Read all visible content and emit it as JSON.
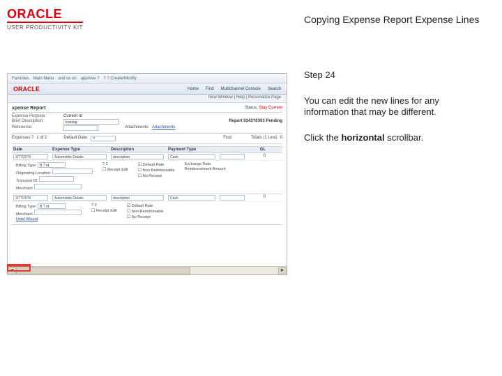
{
  "brand": {
    "name": "ORACLE",
    "product": "USER PRODUCTIVITY KIT"
  },
  "right": {
    "title": "Copying Expense Report Expense Lines",
    "step": "Step 24",
    "para1": "You can edit the new lines for any information that may be different.",
    "para2_pre": "Click the ",
    "para2_bold": "horizontal",
    "para2_post": " scrollbar."
  },
  "shot": {
    "menubar": [
      "Favorites",
      "Main Menu",
      "and so on",
      "approve ?",
      "? ? Create/Modify",
      "?"
    ],
    "toolbar_brand": "ORACLE",
    "toolbar_items": [
      "Home",
      "Find",
      "Multichannel Console",
      "Search"
    ],
    "subbar": "New Window | Help | Personalize Page",
    "report": {
      "title_left": "xpense Report",
      "status_label": "Status:",
      "status_value": "Stay Current",
      "center": "Report 9343?0303  Pending",
      "purpose_k": "Expense Purpose:",
      "purpose_v": "Current rd",
      "desc_k": "Brief Description:",
      "desc_v": "training",
      "ref_k": "Reference:",
      "attach_k": "Attachments:",
      "attach_v": "Attachments",
      "exp_k": "Expenses ?",
      "exp_v": "1  of 2",
      "def_date_k": "Default Date:",
      "def_date_v": "?",
      "find_label": "Find",
      "totals_k": "Totals (1 Line)",
      "totals_v": "0"
    },
    "columns": [
      "Date",
      "Expense Type",
      "Description",
      "Payment Type",
      "",
      "GL"
    ],
    "rows": [
      {
        "date": "3/??/20?0",
        "type": "Automobile Details",
        "desc": "description",
        "pay": "Cash",
        "gl": "0"
      },
      {
        "date": "3/??/20?0",
        "type": "Automobile Details",
        "desc": "description",
        "pay": "Cash",
        "gl": "0"
      }
    ],
    "detail": {
      "billing_type_k": "Billing Type:",
      "billing_type_v": "B  ? rd",
      "originating_k": "Originating Location:",
      "transport_k": "Transport ID:",
      "merchant_k": "Merchant:",
      "miles_k": "? 2",
      "receipt_edit": "Receipt Edit",
      "default_rate": "Default Rate",
      "non_reimb": "Non-Reimbursable",
      "no_receipt": "No Receipt",
      "exchange_rate": "Exchange Rate",
      "reimbursement_amt": "Reimbursement Amount",
      "hotel_wizard": "Hotel Wizard"
    }
  }
}
